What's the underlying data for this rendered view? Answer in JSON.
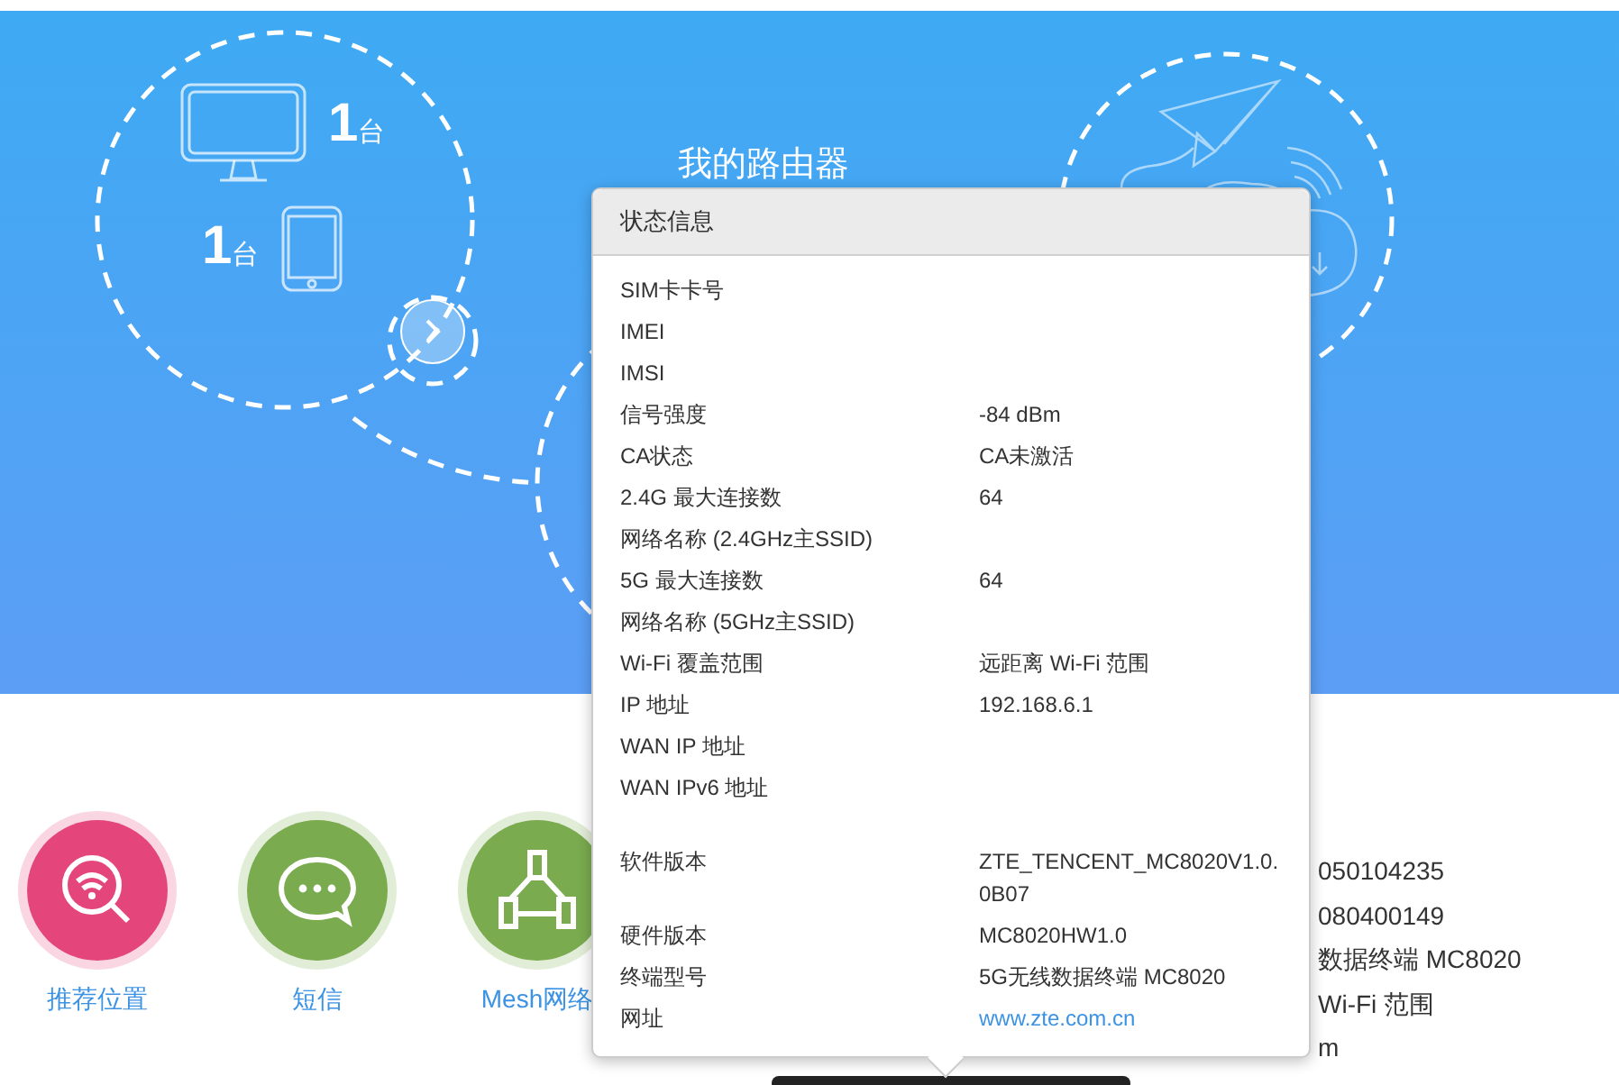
{
  "hero": {
    "router_title": "我的路由器",
    "devices": [
      {
        "kind": "monitor",
        "count": "1",
        "unit": "台"
      },
      {
        "kind": "phone",
        "count": "1",
        "unit": "台"
      }
    ]
  },
  "shortcuts": [
    {
      "label": "推荐位置",
      "kind": "wifi-search",
      "color": "#e4467c"
    },
    {
      "label": "短信",
      "kind": "chat",
      "color": "#7aab4f"
    },
    {
      "label": "Mesh网络",
      "kind": "mesh",
      "color": "#7aab4f"
    }
  ],
  "background_info": [
    "050104235",
    "080400149",
    "数据终端 MC8020",
    "Wi-Fi 范围",
    "m"
  ],
  "status_popup": {
    "title": "状态信息",
    "sections": [
      {
        "rows": [
          {
            "label": "SIM卡卡号",
            "value": "",
            "kind": "text"
          },
          {
            "label": "IMEI",
            "value": "",
            "kind": "text"
          },
          {
            "label": "IMSI",
            "value": "",
            "kind": "text"
          },
          {
            "label": "信号强度",
            "value": "-84 dBm",
            "kind": "text"
          },
          {
            "label": "CA状态",
            "value": "CA未激活",
            "kind": "text"
          },
          {
            "label": "2.4G 最大连接数",
            "value": "64",
            "kind": "text"
          },
          {
            "label": "网络名称 (2.4GHz主SSID)",
            "value": "",
            "kind": "text"
          },
          {
            "label": "5G 最大连接数",
            "value": "64",
            "kind": "text"
          },
          {
            "label": "网络名称 (5GHz主SSID)",
            "value": "",
            "kind": "text"
          },
          {
            "label": "Wi-Fi 覆盖范围",
            "value": "远距离 Wi-Fi 范围",
            "kind": "text"
          },
          {
            "label": "IP 地址",
            "value": "192.168.6.1",
            "kind": "text"
          },
          {
            "label": "WAN IP 地址",
            "value": "",
            "kind": "text"
          },
          {
            "label": "WAN IPv6 地址",
            "value": "",
            "kind": "text"
          }
        ]
      },
      {
        "rows": [
          {
            "label": "软件版本",
            "value": "ZTE_TENCENT_MC8020V1.0.0B07",
            "kind": "text"
          },
          {
            "label": "硬件版本",
            "value": "MC8020HW1.0",
            "kind": "text"
          },
          {
            "label": "终端型号",
            "value": "5G无线数据终端 MC8020",
            "kind": "text"
          },
          {
            "label": "网址",
            "value": "www.zte.com.cn",
            "kind": "link"
          }
        ]
      }
    ]
  }
}
